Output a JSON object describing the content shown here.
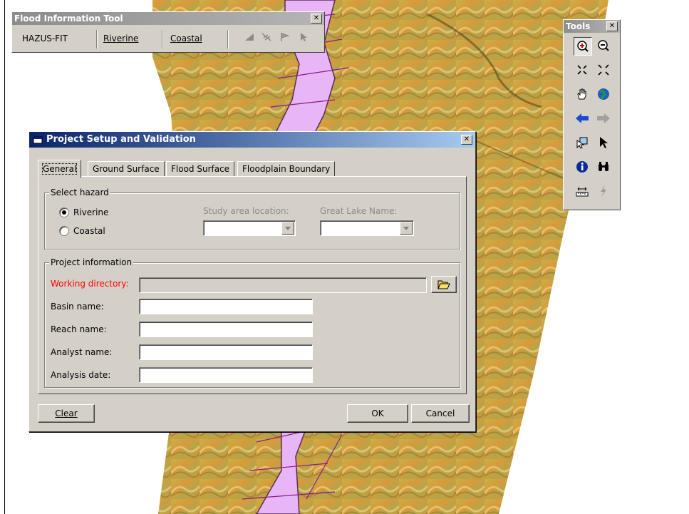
{
  "flood_tool": {
    "title": "Flood Information Tool",
    "close": "✕",
    "menu": [
      {
        "label": "HAZUS-FIT"
      },
      {
        "label": "Riverine"
      },
      {
        "label": "Coastal"
      }
    ]
  },
  "tools_palette": {
    "title": "Tools",
    "close": "✕",
    "icons": [
      "zoom-in-icon",
      "zoom-out-icon",
      "fixed-zoom-in-icon",
      "fixed-zoom-out-icon",
      "pan-icon",
      "full-extent-icon",
      "back-extent-icon",
      "forward-extent-icon",
      "select-features-icon",
      "select-element-icon",
      "identify-icon",
      "find-icon",
      "measure-icon",
      "hyperlink-icon"
    ]
  },
  "dialog": {
    "title": "Project Setup and Validation",
    "close": "✕",
    "tabs": [
      {
        "label": "General"
      },
      {
        "label": "Ground Surface"
      },
      {
        "label": "Flood Surface"
      },
      {
        "label": "Floodplain Boundary"
      }
    ],
    "hazard": {
      "legend": "Select hazard",
      "riverine": "Riverine",
      "coastal": "Coastal",
      "selected": "riverine",
      "study_area_label": "Study area location:",
      "study_area_value": "",
      "great_lake_label": "Great Lake Name:",
      "great_lake_value": ""
    },
    "project": {
      "legend": "Project information",
      "working_directory_label": "Working directory:",
      "working_directory_color": "#ff0000",
      "working_directory_value": "",
      "basin_label": "Basin name:",
      "basin_value": "",
      "reach_label": "Reach name:",
      "reach_value": "",
      "analyst_label": "Analyst name:",
      "analyst_value": "",
      "date_label": "Analysis date:",
      "date_value": ""
    },
    "buttons": {
      "clear": "Clear",
      "ok": "OK",
      "cancel": "Cancel"
    }
  }
}
